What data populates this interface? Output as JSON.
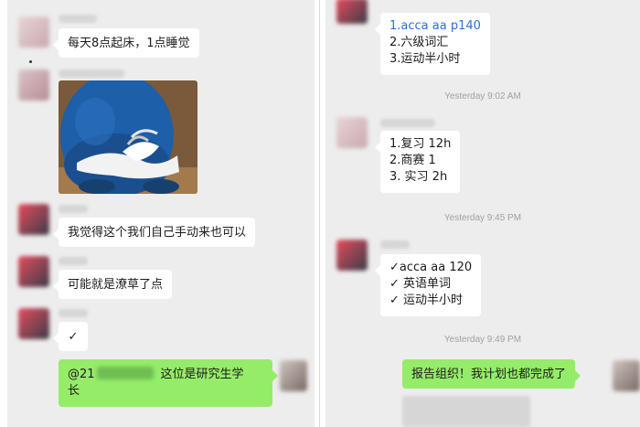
{
  "left_chat": {
    "messages": [
      {
        "text": "每天8点起床，1点睡觉"
      },
      {
        "text": "我觉得这个我们自己手动来也可以"
      },
      {
        "text": "可能就是潦草了点"
      },
      {
        "text": "✓"
      }
    ],
    "mention": {
      "prefix": "@21",
      "rest_line1": "这位是研究生学",
      "rest_line2": "长"
    },
    "sticker": {
      "icon": "cartoon-sticker-image"
    }
  },
  "right_chat": {
    "messages": [
      {
        "lines": [
          "1.acca aa p140",
          "2.六级词汇",
          "3.运动半小时"
        ]
      },
      {
        "lines": [
          "1.复习 12h",
          "2.商赛 1",
          "3. 实习 2h"
        ]
      },
      {
        "lines": [
          "✓acca aa 120",
          "✓ 英语单词",
          "✓ 运动半小时"
        ]
      }
    ],
    "timestamps": [
      "Yesterday 9:02 AM",
      "Yesterday 9:45 PM",
      "Yesterday 9:49 PM"
    ],
    "outgoing": {
      "text": "报告组织！我计划也都完成了"
    }
  },
  "colors": {
    "chat_background": "#ededed",
    "incoming_bubble": "#ffffff",
    "outgoing_bubble": "#95ec69",
    "link_blue": "#2a6fdb"
  }
}
